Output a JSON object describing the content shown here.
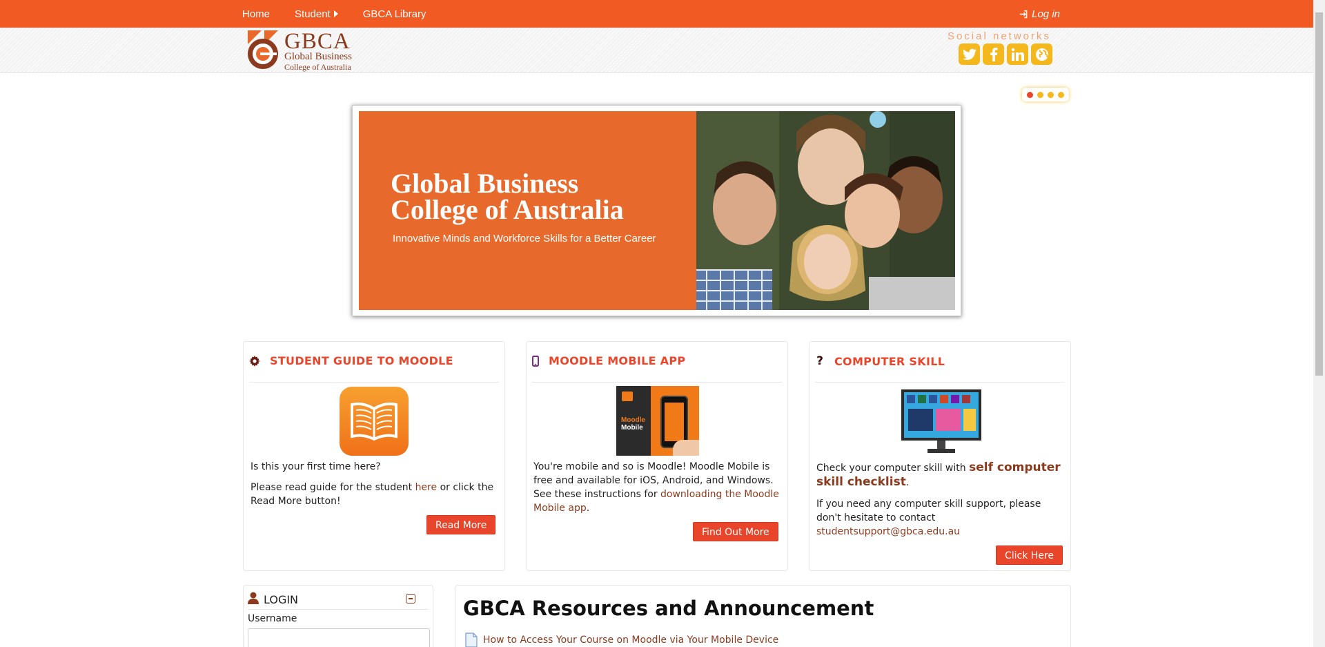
{
  "nav": {
    "items": [
      {
        "label": "Home"
      },
      {
        "label": "Student"
      },
      {
        "label": "GBCA Library"
      }
    ],
    "login_label": "Log in"
  },
  "header": {
    "logo_big": "GBCA",
    "logo_line1": "Global Business",
    "logo_line2": "College of Australia",
    "social_title": "Social networks",
    "social_icons": [
      "twitter-icon",
      "facebook-icon",
      "linkedin-icon",
      "globe-icon"
    ]
  },
  "carousel": {
    "slide_count": 4,
    "active_index": 0
  },
  "banner": {
    "title_line1": "Global Business",
    "title_line2": "College of Australia",
    "subtitle": "Innovative Minds and Workforce Skills for a Better Career"
  },
  "boxes": {
    "moodle_guide": {
      "title": "STUDENT GUIDE TO MOODLE",
      "para1": "Is this your first time here?",
      "para2_before": "Please read guide for the student ",
      "para2_link": "here",
      "para2_after": " or click the Read More button!",
      "button": "Read More"
    },
    "mobile_app": {
      "title": "MOODLE MOBILE APP",
      "para1_before": "You're mobile and so is Moodle! Moodle Mobile is free and available for iOS, Android, and Windows. See these instructions for ",
      "para1_link": "downloading the Moodle Mobile app",
      "para1_after": ".",
      "image_label_1": "Moodle",
      "image_label_2": "Mobile",
      "button": "Find Out More"
    },
    "computer_skill": {
      "title": "COMPUTER SKILL",
      "para1_before": "Check your computer skill with ",
      "para1_link": "self computer skill checklist",
      "para1_after": ".",
      "para2_before": "If you need any computer skill support, please don't hesitate to contact ",
      "para2_link": "studentsupport@gbca.edu.au",
      "button": "Click Here"
    }
  },
  "login_block": {
    "title": "LOGIN",
    "username_label": "Username"
  },
  "resources": {
    "title": "GBCA Resources and Announcement",
    "items": [
      "How to Access Your Course on Moodle via Your Mobile Device"
    ]
  },
  "colors": {
    "brand_orange": "#f15a22",
    "accent_red": "#e9452a",
    "link_brown": "#8b3a1e",
    "social_yellow": "#f5b81c"
  }
}
